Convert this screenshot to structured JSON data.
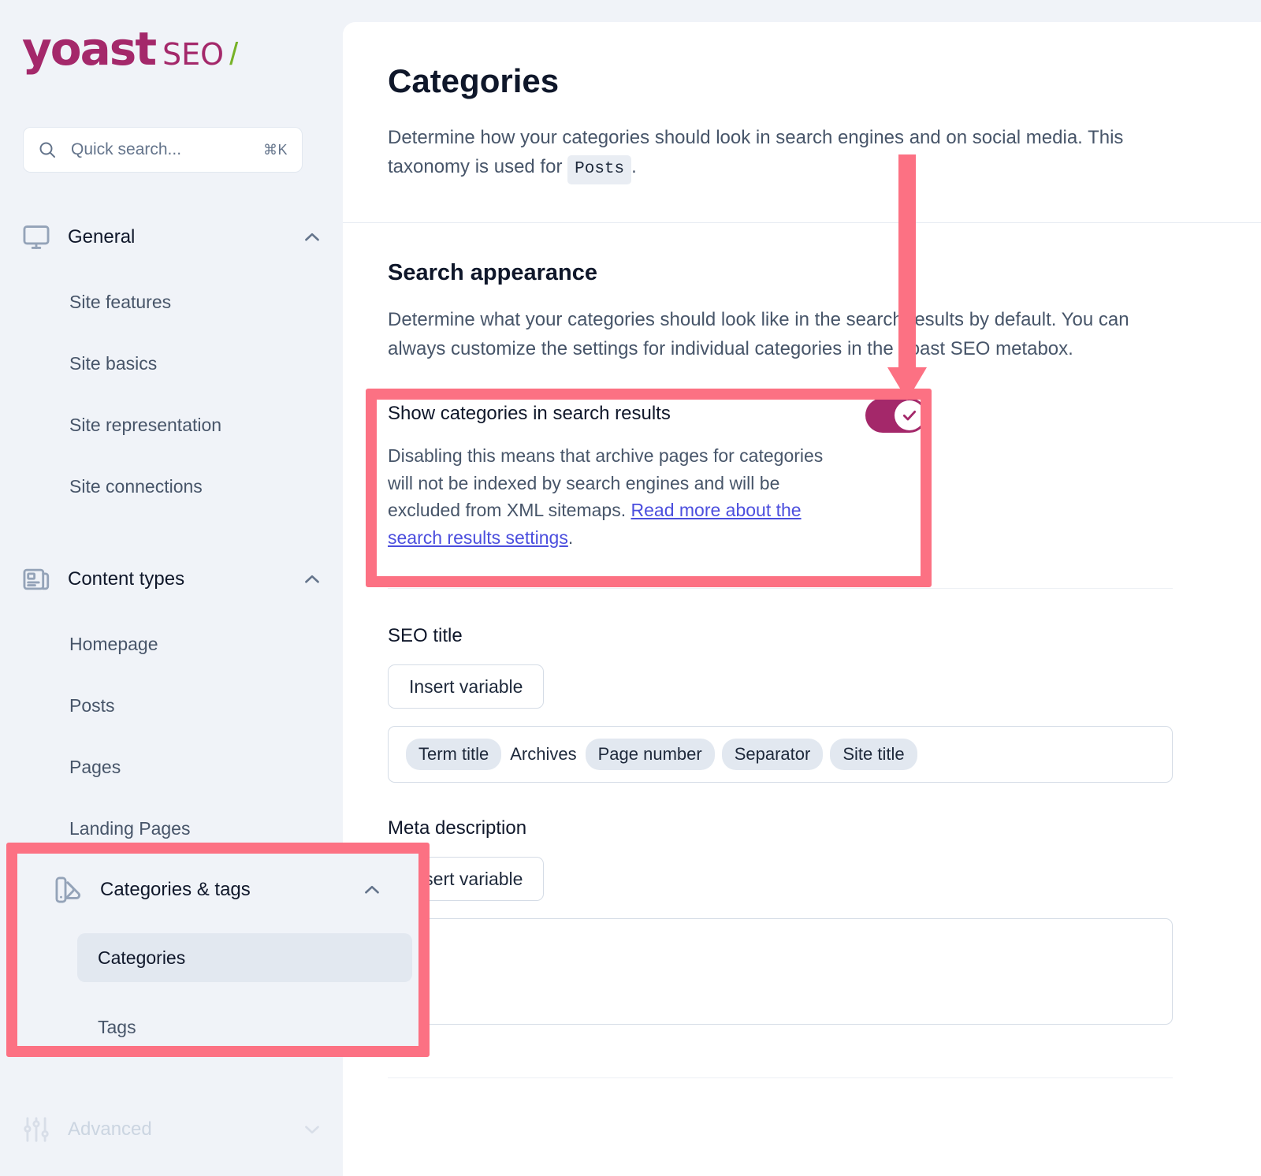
{
  "brand": {
    "name_primary": "yoast",
    "name_secondary": "SEO",
    "slash": "/",
    "accent_magenta": "#A4286A",
    "accent_green": "#77B227"
  },
  "search": {
    "placeholder": "Quick search...",
    "shortcut": "⌘K",
    "icon": "search-icon"
  },
  "sidebar": {
    "groups": [
      {
        "label": "General",
        "icon": "monitor-icon",
        "expanded": true,
        "chevron": "chevron-up-icon",
        "items": [
          {
            "label": "Site features",
            "active": false
          },
          {
            "label": "Site basics",
            "active": false
          },
          {
            "label": "Site representation",
            "active": false
          },
          {
            "label": "Site connections",
            "active": false
          }
        ]
      },
      {
        "label": "Content types",
        "icon": "newspaper-icon",
        "expanded": true,
        "chevron": "chevron-up-icon",
        "items": [
          {
            "label": "Homepage",
            "active": false
          },
          {
            "label": "Posts",
            "active": false
          },
          {
            "label": "Pages",
            "active": false
          },
          {
            "label": "Landing Pages",
            "active": false
          }
        ]
      },
      {
        "label": "Categories & tags",
        "icon": "tag-swatch-icon",
        "expanded": true,
        "chevron": "chevron-up-icon",
        "items": [
          {
            "label": "Categories",
            "active": true
          },
          {
            "label": "Tags",
            "active": false
          }
        ]
      },
      {
        "label": "Advanced",
        "icon": "sliders-icon",
        "expanded": false,
        "chevron": "chevron-down-icon",
        "muted": true,
        "items": []
      }
    ]
  },
  "main": {
    "title": "Categories",
    "description_part1": "Determine how your categories should look in search engines and on social media. This taxonomy is used for",
    "description_chip": "Posts",
    "description_part2": ".",
    "search_appearance": {
      "title": "Search appearance",
      "description": "Determine what your categories should look like in the search results by default. You can always customize the settings for individual categories in the Yoast SEO metabox.",
      "toggle": {
        "label": "Show categories in search results",
        "state": "on",
        "help_text": "Disabling this means that archive pages for categories will not be indexed by search engines and will be excluded from XML sitemaps.",
        "link_text": "Read more about the search results settings",
        "help_suffix": "."
      }
    },
    "seo_title": {
      "label": "SEO title",
      "insert_button": "Insert variable",
      "tokens": [
        {
          "text": "Term title",
          "type": "pill"
        },
        {
          "text": "Archives",
          "type": "plain"
        },
        {
          "text": "Page number",
          "type": "pill"
        },
        {
          "text": "Separator",
          "type": "pill"
        },
        {
          "text": "Site title",
          "type": "pill"
        }
      ]
    },
    "meta_description": {
      "label": "Meta description",
      "insert_button": "Insert variable",
      "value": ""
    }
  },
  "annotations": {
    "highlight_color": "#FC7183",
    "arrow": "down-arrow-annotation",
    "boxes": [
      "toggle-highlight",
      "sidebar-categories-highlight"
    ]
  }
}
